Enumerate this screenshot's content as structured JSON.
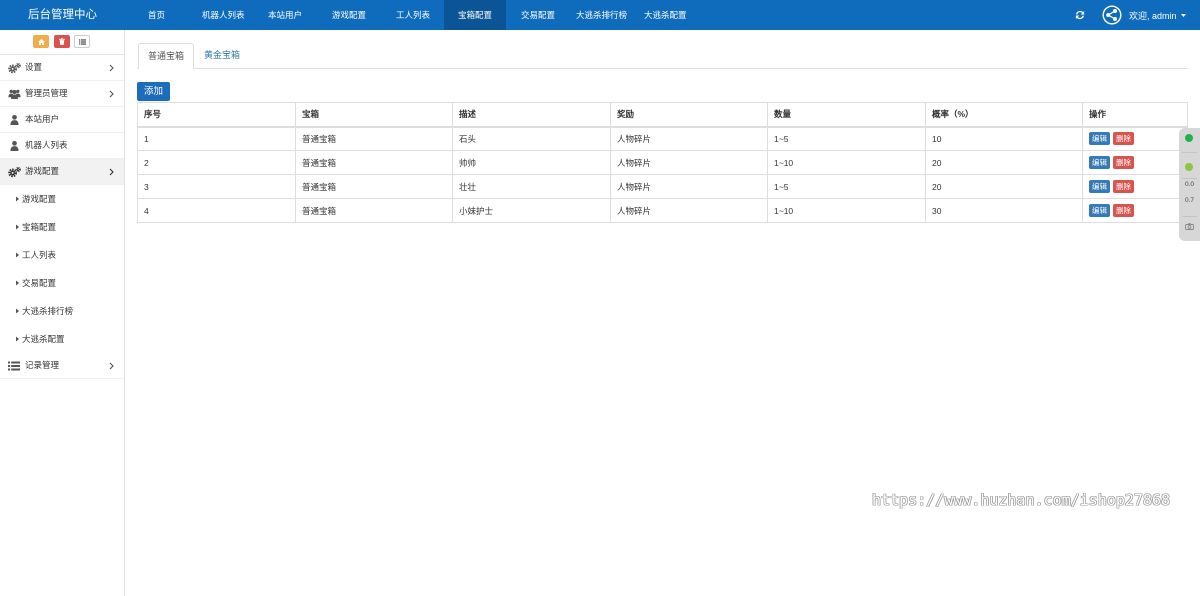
{
  "app": {
    "title": "后台管理中心"
  },
  "topnav": {
    "items": [
      {
        "label": "首页"
      },
      {
        "label": "机器人列表"
      },
      {
        "label": "本站用户"
      },
      {
        "label": "游戏配置"
      },
      {
        "label": "工人列表"
      },
      {
        "label": "宝箱配置",
        "active": true
      },
      {
        "label": "交易配置"
      },
      {
        "label": "大逃杀排行榜"
      },
      {
        "label": "大逃杀配置"
      }
    ],
    "refresh_icon": "refresh-icon",
    "share_icon": "share-alt-icon",
    "user_menu": {
      "welcome": "欢迎, admin",
      "icon": "caret-down-icon"
    }
  },
  "sidebar": {
    "quick_buttons": [
      {
        "icon": "home-icon",
        "color": "#f0ad4e"
      },
      {
        "icon": "trash-icon",
        "color": "#d9534f"
      },
      {
        "icon": "list-icon",
        "color": "#ffffff"
      }
    ],
    "menu": [
      {
        "label": "设置",
        "icon": "gears-icon",
        "has_children": true
      },
      {
        "label": "管理员管理",
        "icon": "users-icon",
        "has_children": true
      },
      {
        "label": "本站用户",
        "icon": "user-icon"
      },
      {
        "label": "机器人列表",
        "icon": "user-icon"
      },
      {
        "label": "游戏配置",
        "icon": "gears-icon",
        "has_children": true,
        "expanded": true,
        "children": [
          {
            "label": "游戏配置"
          },
          {
            "label": "宝箱配置"
          },
          {
            "label": "工人列表"
          },
          {
            "label": "交易配置"
          },
          {
            "label": "大逃杀排行榜"
          },
          {
            "label": "大逃杀配置"
          }
        ]
      },
      {
        "label": "记录管理",
        "icon": "list-icon",
        "has_children": true
      }
    ]
  },
  "tabs": [
    {
      "label": "普通宝箱",
      "active": true
    },
    {
      "label": "黄金宝箱"
    }
  ],
  "toolbar": {
    "add_label": "添加"
  },
  "table": {
    "columns": [
      "序号",
      "宝箱",
      "描述",
      "奖励",
      "数量",
      "概率（%）",
      "操作"
    ],
    "rows": [
      {
        "id": "1",
        "box": "普通宝箱",
        "desc": "石头",
        "reward": "人物碎片",
        "qty": "1~5",
        "prob": "10"
      },
      {
        "id": "2",
        "box": "普通宝箱",
        "desc": "帅帅",
        "reward": "人物碎片",
        "qty": "1~10",
        "prob": "20"
      },
      {
        "id": "3",
        "box": "普通宝箱",
        "desc": "壮壮",
        "reward": "人物碎片",
        "qty": "1~5",
        "prob": "20"
      },
      {
        "id": "4",
        "box": "普通宝箱",
        "desc": "小妹护士",
        "reward": "人物碎片",
        "qty": "1~10",
        "prob": "30"
      }
    ],
    "edit_label": "编辑",
    "delete_label": "删除"
  },
  "side_widget": {
    "readings": [
      "0.0",
      "0.7"
    ],
    "icon": "camera-icon"
  },
  "watermark": "https://www.huzhan.com/ishop27868",
  "colors": {
    "topbar": "#0f6cbd",
    "topbar_active": "#0b5597",
    "primary_button": "#1b6dbb",
    "edit_button": "#337ab7",
    "delete_button": "#d9534f",
    "link": "#337ab7",
    "status_green": "#22b14c"
  }
}
